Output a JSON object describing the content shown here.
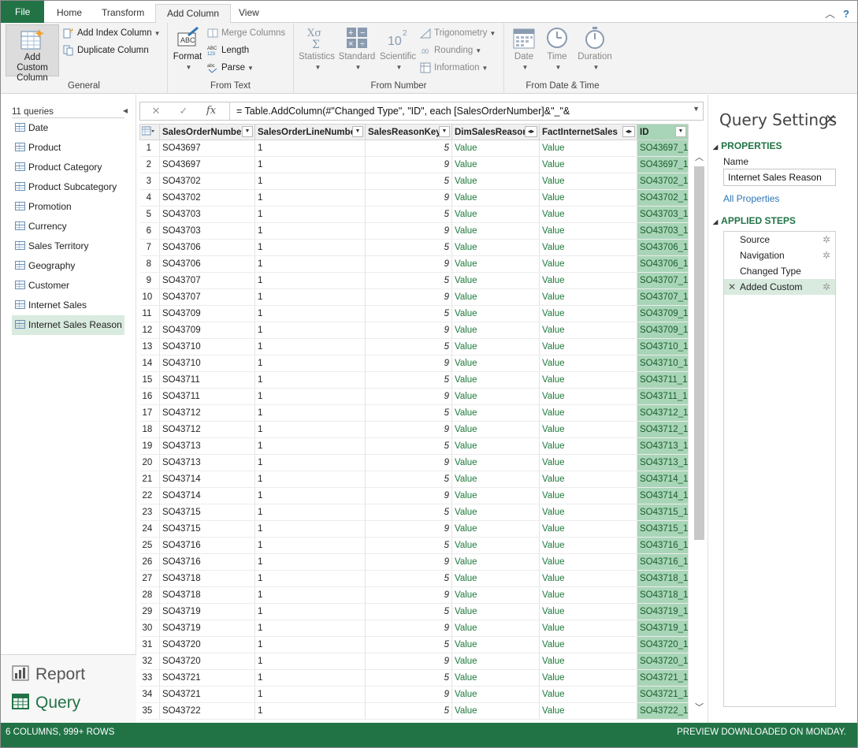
{
  "tabs": {
    "file": "File",
    "home": "Home",
    "transform": "Transform",
    "add_column": "Add Column",
    "view": "View"
  },
  "ribbon": {
    "general": {
      "label": "General",
      "add_custom_column": "Add Custom Column",
      "add_index_column": "Add Index Column",
      "duplicate_column": "Duplicate Column"
    },
    "from_text": {
      "label": "From Text",
      "format": "Format",
      "merge_columns": "Merge Columns",
      "length": "Length",
      "parse": "Parse"
    },
    "from_number": {
      "label": "From Number",
      "statistics": "Statistics",
      "standard": "Standard",
      "scientific": "Scientific",
      "trigonometry": "Trigonometry",
      "rounding": "Rounding",
      "information": "Information"
    },
    "from_date_time": {
      "label": "From Date & Time",
      "date": "Date",
      "time": "Time",
      "duration": "Duration"
    }
  },
  "queries": {
    "count_label": "11 queries",
    "items": [
      "Date",
      "Product",
      "Product Category",
      "Product Subcategory",
      "Promotion",
      "Currency",
      "Sales Territory",
      "Geography",
      "Customer",
      "Internet Sales",
      "Internet Sales Reason"
    ],
    "selected_index": 10
  },
  "views": {
    "report": "Report",
    "query": "Query"
  },
  "formula": {
    "cancel_glyph": "✕",
    "confirm_glyph": "✓",
    "fx_glyph": "fx",
    "text": "= Table.AddColumn(#\"Changed Type\", \"ID\", each [SalesOrderNumber]&\"_\"&"
  },
  "grid": {
    "columns": [
      "SalesOrderNumber",
      "SalesOrderLineNumber",
      "SalesReasonKey",
      "DimSalesReason",
      "FactInternetSales",
      "ID"
    ],
    "rows": [
      [
        "1",
        "SO43697",
        "1",
        "5",
        "Value",
        "Value",
        "SO43697_1"
      ],
      [
        "2",
        "SO43697",
        "1",
        "9",
        "Value",
        "Value",
        "SO43697_1"
      ],
      [
        "3",
        "SO43702",
        "1",
        "5",
        "Value",
        "Value",
        "SO43702_1"
      ],
      [
        "4",
        "SO43702",
        "1",
        "9",
        "Value",
        "Value",
        "SO43702_1"
      ],
      [
        "5",
        "SO43703",
        "1",
        "5",
        "Value",
        "Value",
        "SO43703_1"
      ],
      [
        "6",
        "SO43703",
        "1",
        "9",
        "Value",
        "Value",
        "SO43703_1"
      ],
      [
        "7",
        "SO43706",
        "1",
        "5",
        "Value",
        "Value",
        "SO43706_1"
      ],
      [
        "8",
        "SO43706",
        "1",
        "9",
        "Value",
        "Value",
        "SO43706_1"
      ],
      [
        "9",
        "SO43707",
        "1",
        "5",
        "Value",
        "Value",
        "SO43707_1"
      ],
      [
        "10",
        "SO43707",
        "1",
        "9",
        "Value",
        "Value",
        "SO43707_1"
      ],
      [
        "11",
        "SO43709",
        "1",
        "5",
        "Value",
        "Value",
        "SO43709_1"
      ],
      [
        "12",
        "SO43709",
        "1",
        "9",
        "Value",
        "Value",
        "SO43709_1"
      ],
      [
        "13",
        "SO43710",
        "1",
        "5",
        "Value",
        "Value",
        "SO43710_1"
      ],
      [
        "14",
        "SO43710",
        "1",
        "9",
        "Value",
        "Value",
        "SO43710_1"
      ],
      [
        "15",
        "SO43711",
        "1",
        "5",
        "Value",
        "Value",
        "SO43711_1"
      ],
      [
        "16",
        "SO43711",
        "1",
        "9",
        "Value",
        "Value",
        "SO43711_1"
      ],
      [
        "17",
        "SO43712",
        "1",
        "5",
        "Value",
        "Value",
        "SO43712_1"
      ],
      [
        "18",
        "SO43712",
        "1",
        "9",
        "Value",
        "Value",
        "SO43712_1"
      ],
      [
        "19",
        "SO43713",
        "1",
        "5",
        "Value",
        "Value",
        "SO43713_1"
      ],
      [
        "20",
        "SO43713",
        "1",
        "9",
        "Value",
        "Value",
        "SO43713_1"
      ],
      [
        "21",
        "SO43714",
        "1",
        "5",
        "Value",
        "Value",
        "SO43714_1"
      ],
      [
        "22",
        "SO43714",
        "1",
        "9",
        "Value",
        "Value",
        "SO43714_1"
      ],
      [
        "23",
        "SO43715",
        "1",
        "5",
        "Value",
        "Value",
        "SO43715_1"
      ],
      [
        "24",
        "SO43715",
        "1",
        "9",
        "Value",
        "Value",
        "SO43715_1"
      ],
      [
        "25",
        "SO43716",
        "1",
        "5",
        "Value",
        "Value",
        "SO43716_1"
      ],
      [
        "26",
        "SO43716",
        "1",
        "9",
        "Value",
        "Value",
        "SO43716_1"
      ],
      [
        "27",
        "SO43718",
        "1",
        "5",
        "Value",
        "Value",
        "SO43718_1"
      ],
      [
        "28",
        "SO43718",
        "1",
        "9",
        "Value",
        "Value",
        "SO43718_1"
      ],
      [
        "29",
        "SO43719",
        "1",
        "5",
        "Value",
        "Value",
        "SO43719_1"
      ],
      [
        "30",
        "SO43719",
        "1",
        "9",
        "Value",
        "Value",
        "SO43719_1"
      ],
      [
        "31",
        "SO43720",
        "1",
        "5",
        "Value",
        "Value",
        "SO43720_1"
      ],
      [
        "32",
        "SO43720",
        "1",
        "9",
        "Value",
        "Value",
        "SO43720_1"
      ],
      [
        "33",
        "SO43721",
        "1",
        "5",
        "Value",
        "Value",
        "SO43721_1"
      ],
      [
        "34",
        "SO43721",
        "1",
        "9",
        "Value",
        "Value",
        "SO43721_1"
      ],
      [
        "35",
        "SO43722",
        "1",
        "5",
        "Value",
        "Value",
        "SO43722_1"
      ]
    ]
  },
  "settings": {
    "title": "Query Settings",
    "close_glyph": "✕",
    "properties_label": "PROPERTIES",
    "name_label": "Name",
    "name_value": "Internet Sales Reason",
    "all_properties": "All Properties",
    "applied_steps_label": "APPLIED STEPS",
    "steps": [
      {
        "label": "Source",
        "gear": true,
        "selected": false
      },
      {
        "label": "Navigation",
        "gear": true,
        "selected": false
      },
      {
        "label": "Changed Type",
        "gear": false,
        "selected": false
      },
      {
        "label": "Added Custom",
        "gear": true,
        "selected": true
      }
    ]
  },
  "status": {
    "left": "6 COLUMNS, 999+ ROWS",
    "right": "PREVIEW DOWNLOADED ON MONDAY."
  },
  "colors": {
    "accent": "#217346",
    "id_column": "#a8d5b7",
    "selected_row": "#d9eadf",
    "link": "#2e75b6"
  }
}
